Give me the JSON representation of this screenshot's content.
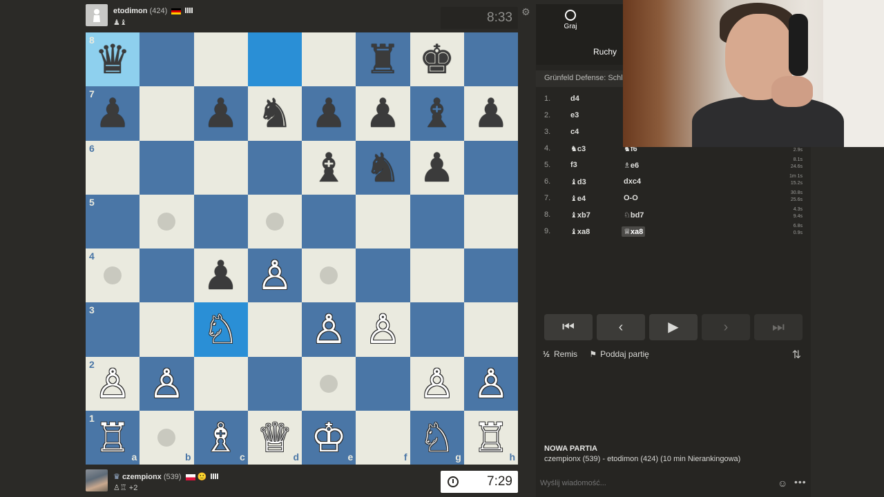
{
  "top_player": {
    "name": "etodimon",
    "rating": "(424)",
    "flag": "de",
    "captured": "♟♝",
    "clock": "8:33"
  },
  "bottom_player": {
    "name": "czempionx",
    "rating": "(539)",
    "flag": "pl",
    "extra": "🙂",
    "captured": "♙♖ +2",
    "clock": "7:29"
  },
  "board": {
    "files": [
      "a",
      "b",
      "c",
      "d",
      "e",
      "f",
      "g",
      "h"
    ],
    "ranks": [
      "8",
      "7",
      "6",
      "5",
      "4",
      "3",
      "2",
      "1"
    ],
    "pieces": [
      [
        "♛",
        "",
        "",
        "",
        "",
        "♜",
        "♚",
        ""
      ],
      [
        "♟",
        "",
        "♟",
        "♞",
        "♟",
        "♟",
        "♝",
        "♟"
      ],
      [
        "",
        "",
        "",
        "",
        "♝",
        "♞",
        "♟",
        ""
      ],
      [
        "",
        "",
        "",
        "",
        "",
        "",
        "",
        ""
      ],
      [
        "",
        "",
        "♟",
        "♙",
        "",
        "",
        "",
        ""
      ],
      [
        "",
        "",
        "♘",
        "",
        "♙",
        "♙",
        "",
        ""
      ],
      [
        "♙",
        "♙",
        "",
        "",
        "",
        "",
        "♙",
        "♙"
      ],
      [
        "♖",
        "",
        "♗",
        "♕",
        "♔",
        "",
        "♘",
        "♖"
      ]
    ],
    "colors": [
      [
        "b",
        "",
        "",
        "",
        "",
        "b",
        "b",
        ""
      ],
      [
        "b",
        "",
        "b",
        "b",
        "b",
        "b",
        "b",
        "b"
      ],
      [
        "",
        "",
        "",
        "",
        "b",
        "b",
        "b",
        ""
      ],
      [
        "",
        "",
        "",
        "",
        "",
        "",
        "",
        ""
      ],
      [
        "",
        "",
        "b",
        "w",
        "",
        "",
        "",
        ""
      ],
      [
        "",
        "",
        "w",
        "",
        "w",
        "w",
        "",
        ""
      ],
      [
        "w",
        "w",
        "",
        "",
        "",
        "",
        "w",
        "w"
      ],
      [
        "w",
        "",
        "w",
        "w",
        "w",
        "",
        "w",
        "w"
      ]
    ],
    "dots": [
      "b5",
      "d5",
      "a4",
      "e4",
      "e2",
      "b1"
    ],
    "highlights": [
      "a8",
      "d8",
      "c3"
    ]
  },
  "panel": {
    "tab_play": "Graj",
    "subtab_moves": "Ruchy",
    "opening": "Grünfeld Defense: Schlec",
    "moves": [
      {
        "num": "1.",
        "white": "d4",
        "black": "",
        "wt": "",
        "bt": ""
      },
      {
        "num": "2.",
        "white": "e3",
        "black": "",
        "wt": "",
        "bt": ""
      },
      {
        "num": "3.",
        "white": "c4",
        "black": "",
        "wt": "",
        "bt": ""
      },
      {
        "num": "4.",
        "white": "♞c3",
        "black": "♞f6",
        "wt": "",
        "bt": "2.9s"
      },
      {
        "num": "5.",
        "white": "f3",
        "black": "♗e6",
        "wt": "8.1s",
        "bt": "24.6s"
      },
      {
        "num": "6.",
        "white": "♝d3",
        "black": "dxc4",
        "wt": "1m 1s",
        "bt": "15.2s"
      },
      {
        "num": "7.",
        "white": "♝e4",
        "black": "O-O",
        "wt": "30.8s",
        "bt": "25.6s"
      },
      {
        "num": "8.",
        "white": "♝xb7",
        "black": "♘bd7",
        "wt": "4.3s",
        "bt": "9.4s"
      },
      {
        "num": "9.",
        "white": "♝xa8",
        "black": "♕xa8",
        "wt": "6.8s",
        "bt": "0.9s"
      }
    ],
    "nav": {
      "first": "⏮",
      "prev": "‹",
      "play": "▶",
      "next": "›",
      "last": "⏭"
    },
    "draw_label": "Remis",
    "resign_label": "Poddaj partię",
    "game_title": "NOWA PARTIA",
    "game_desc": "czempionx (539) - etodimon (424) (10 min Nierankingowa)",
    "chat_placeholder": "Wyślij wiadomość..."
  },
  "colors": {
    "board_light": "#eaeadf",
    "board_dark": "#4a76a6",
    "highlight": "#2a8fd6"
  }
}
